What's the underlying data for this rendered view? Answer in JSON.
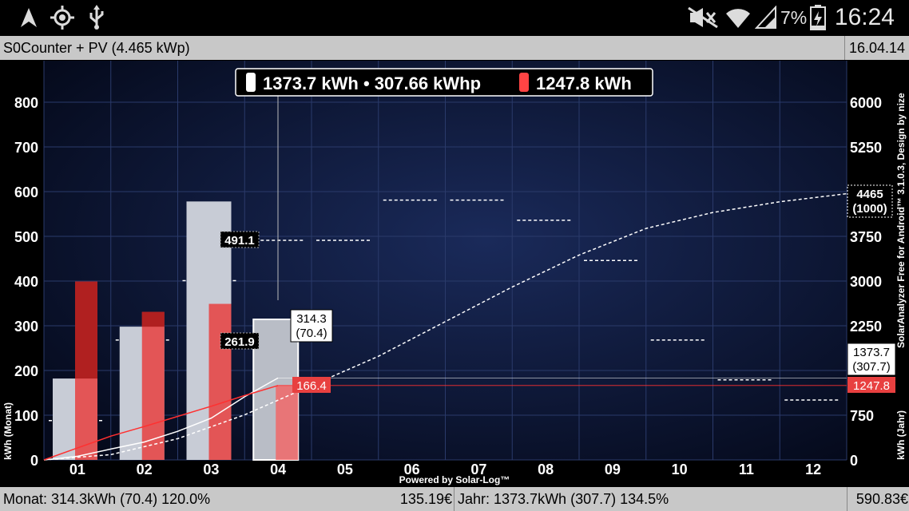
{
  "status_bar": {
    "left_icons": [
      "navigation-icon",
      "gps-icon",
      "usb-icon"
    ],
    "right_icons": [
      "mute-icon",
      "wifi-icon",
      "signal-icon",
      "battery-icon"
    ],
    "battery": "7%",
    "time": "16:24"
  },
  "title_bar": {
    "title": "S0Counter + PV (4.465 kWp)",
    "date": "16.04.14"
  },
  "legend": {
    "white_text": "1373.7 kWh • 307.66 kWhp",
    "red_text": "1247.8 kWh",
    "white_color": "#ffffff",
    "red_color": "#ff4444"
  },
  "chart_data": {
    "type": "bar",
    "categories": [
      "01",
      "02",
      "03",
      "04",
      "05",
      "06",
      "07",
      "08",
      "09",
      "10",
      "11",
      "12"
    ],
    "left_axis": {
      "label": "kWh (Monat)",
      "ylim": [
        0,
        800
      ],
      "ticks": [
        0,
        100,
        200,
        300,
        400,
        500,
        600,
        700,
        800
      ]
    },
    "right_axis": {
      "label": "kWh (Jahr)",
      "ylim": [
        0,
        6000
      ],
      "ticks": [
        0,
        750,
        1500,
        2250,
        3000,
        3750,
        4500,
        5250,
        6000
      ],
      "tick_labels": [
        "0",
        "750",
        "",
        "2250",
        "3000",
        "3750",
        "",
        "5250",
        "6000"
      ]
    },
    "series": [
      {
        "values": [
          182,
          298,
          578,
          314.3
        ]
      },
      {
        "values": [
          399,
          331,
          349,
          166.4
        ]
      }
    ],
    "reference": [
      88,
      268,
      401,
      491,
      491,
      581,
      581,
      536,
      446,
      268,
      179,
      134
    ],
    "cumulative_actual": [
      [
        0,
        0
      ],
      [
        0.5,
        60
      ],
      [
        1,
        182
      ],
      [
        1.5,
        300
      ],
      [
        2,
        480
      ],
      [
        2.5,
        700
      ],
      [
        3,
        1059
      ],
      [
        3.5,
        1373.7
      ]
    ],
    "cumulative_red": [
      [
        0,
        0
      ],
      [
        0.5,
        200
      ],
      [
        1,
        399
      ],
      [
        1.5,
        560
      ],
      [
        2,
        730
      ],
      [
        2.5,
        900
      ],
      [
        3,
        1079
      ],
      [
        3.5,
        1247.8
      ]
    ],
    "cumulative_reference": [
      [
        0,
        0
      ],
      [
        1,
        88
      ],
      [
        2,
        356
      ],
      [
        3,
        757
      ],
      [
        4,
        1248
      ],
      [
        5,
        1739
      ],
      [
        6,
        2320
      ],
      [
        7,
        2901
      ],
      [
        8,
        3437
      ],
      [
        9,
        3883
      ],
      [
        10,
        4151
      ],
      [
        11,
        4330
      ],
      [
        12,
        4465
      ]
    ],
    "annotations": {
      "ref_prev_1": "491.1",
      "ref_prev_2": "261.9",
      "current_value": "314.3",
      "current_kwhp": "(70.4)",
      "current_red": "166.4",
      "year_target_1": "4465",
      "year_target_2": "(1000)",
      "year_actual_1": "1373.7",
      "year_actual_2": "(307.7)",
      "year_red": "1247.8"
    },
    "side_text": "SolarAnalyzer Free for Android™ 3.1.0.3, Design by nize",
    "powered_by": "Powered by Solar-Log™",
    "grid": true
  },
  "footer": {
    "month": "Monat: 314.3kWh (70.4) 120.0%",
    "month_money": "135.19€",
    "year": "Jahr: 1373.7kWh (307.7) 134.5%",
    "year_money": "590.83€"
  },
  "colors": {
    "background": "#0a1430",
    "grid": "#2a3a6a",
    "white_bar": "#c8ccd6",
    "red_bar": "#e84040",
    "bar_bar": "#c8c8c8"
  }
}
